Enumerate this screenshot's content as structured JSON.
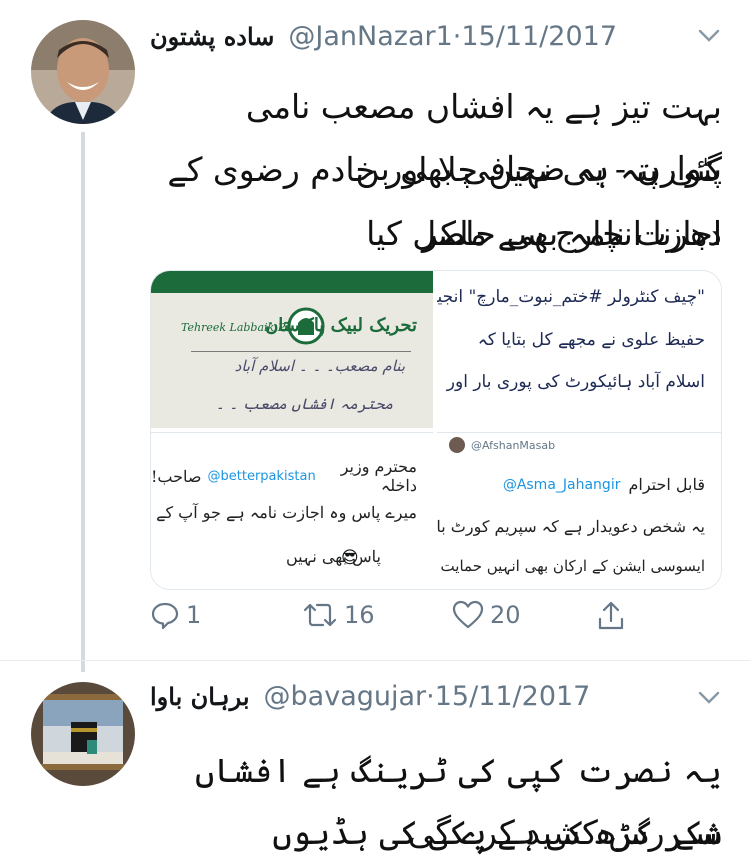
{
  "tweet1": {
    "display_name": "ساده پشتون",
    "handle": "@JanNazar1",
    "date": "15/11/2017",
    "text_lines": [
      "بہت تیز ہے یہ افشاں مصعب نامی پٹوارن - یہ صحافی بھی بن",
      "گئی پتہ ہی نہیں چلا اور خادم رضوی کے دھرنا انچارج سے ملکر",
      "اجازت نامہ بھی حاصل کیا"
    ],
    "media": {
      "p1_banner": "Tehreek Labbaik Pakistan",
      "p1_urdu_logo": "تحریک لبیک پاکستان",
      "p1_lines": [
        "بنام مصعب۔ ۔ ۔ اسلام آباد",
        "محترمہ افشاں مصعب ۔ ۔"
      ],
      "p2_lines": [
        "\"چیف کنٹرولر #ختم_نبوت_مارچ\" انجینئر",
        "حفیظ علوی نے مجھے کل بتایا کہ",
        "اسلام آباد ہائیکورٹ کی پوری بار اور"
      ],
      "p3_handle": "@betterpakistan",
      "p3_lines": [
        "محترم وزیر داخلہ",
        "صاحب!",
        "میرے پاس وہ اجازت نامہ ہے جو آپ کے",
        "پاس بھی نہیں"
      ],
      "p4_author": "@AfshanMasab",
      "p4_handle": "@Asma_Jahangir",
      "p4_lines": [
        "قابل احترام",
        "یہ شخص دعویدار ہے کہ سپریم کورٹ بار",
        "ایسوسی ایشن کے ارکان بھی انہیں حمایت کا"
      ]
    },
    "actions": {
      "replies": "1",
      "retweets": "16",
      "likes": "20"
    }
  },
  "tweet2": {
    "display_name": "برہان باوا",
    "handle": "@bavagujar",
    "date": "15/11/2017",
    "text_lines": [
      "یہ نصرت کپی کی ٹرینگ ہے افشاں شکر گڑھ کی ہے پکی کی ہڈیوں",
      "سے رس کشید کرے گی"
    ]
  },
  "separator": " · ",
  "colors": {
    "secondary": "#657786",
    "border": "#e1e8ed",
    "thread": "#d3dae0",
    "doc_green": "#1c6b3b"
  }
}
